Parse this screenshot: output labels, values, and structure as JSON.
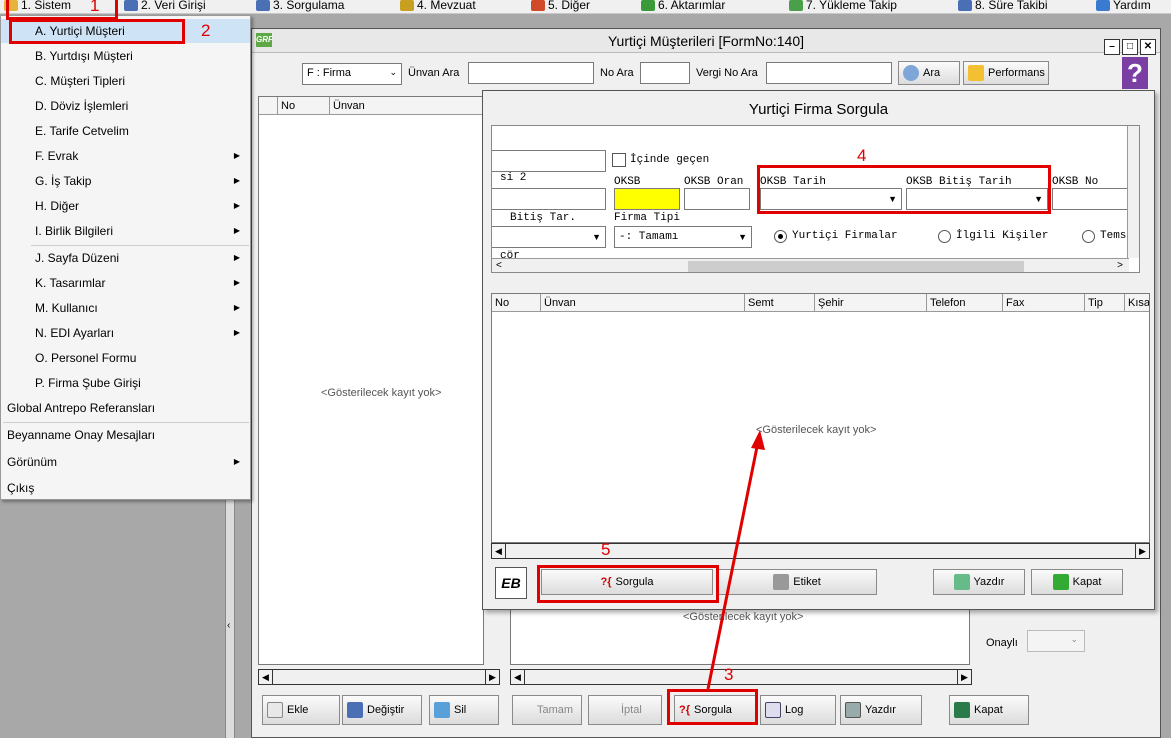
{
  "menubar": {
    "items": [
      {
        "label": "1. Sistem",
        "color": "#e8b33a"
      },
      {
        "label": "2. Veri Girişi",
        "color": "#4a6fb5"
      },
      {
        "label": "3. Sorgulama",
        "color": "#4a6fb5"
      },
      {
        "label": "4. Mevzuat",
        "color": "#c8a020"
      },
      {
        "label": "5. Diğer",
        "color": "#d04a2a"
      },
      {
        "label": "6. Aktarımlar",
        "color": "#3a9a3a"
      },
      {
        "label": "7. Yükleme Takip",
        "color": "#4aa04a"
      },
      {
        "label": "8. Süre Takibi",
        "color": "#4a6fb5"
      },
      {
        "label": "Yardım",
        "color": "#3a7ad0"
      }
    ]
  },
  "sistem_menu": {
    "items": [
      {
        "label": "A. Yurtiçi Müşteri",
        "submenu": false
      },
      {
        "label": "B. Yurtdışı Müşteri",
        "submenu": false
      },
      {
        "label": "C. Müşteri Tipleri",
        "submenu": false
      },
      {
        "label": "D. Döviz İşlemleri",
        "submenu": false
      },
      {
        "label": "E. Tarife Cetvelim",
        "submenu": false
      },
      {
        "label": "F. Evrak",
        "submenu": true
      },
      {
        "label": "G. İş Takip",
        "submenu": true
      },
      {
        "label": "H. Diğer",
        "submenu": true
      },
      {
        "label": "I. Birlik Bilgileri",
        "submenu": true
      },
      {
        "label": "J. Sayfa Düzeni",
        "submenu": true
      },
      {
        "label": "K. Tasarımlar",
        "submenu": true
      },
      {
        "label": "M. Kullanıcı",
        "submenu": true
      },
      {
        "label": "N. EDI Ayarları",
        "submenu": true
      },
      {
        "label": "O. Personel Formu",
        "submenu": false
      },
      {
        "label": "P. Firma Şube Girişi",
        "submenu": false
      },
      {
        "label": "Global Antrepo Referansları",
        "submenu": false
      },
      {
        "label": "Beyanname Onay Mesajları",
        "submenu": false
      },
      {
        "label": "Görünüm",
        "submenu": true
      },
      {
        "label": "Çıkış",
        "submenu": false
      }
    ]
  },
  "main_window": {
    "title": "Yurtiçi Müşterileri [FormNo:140]",
    "logo": "GRF",
    "type_select": "F : Firma",
    "unvan_label": "Ünvan Ara",
    "no_label": "No Ara",
    "vergi_label": "Vergi No Ara",
    "search_button": "Ara",
    "performance_button": "Performans",
    "help": "?",
    "left_grid": {
      "col_no": "No",
      "col_unvan": "Ünvan",
      "empty": "<Gösterilecek kayıt yok>"
    },
    "bottom_grid_empty": "<Gösterilecek kayıt yok>",
    "onayli_label": "Onaylı",
    "toolbar": {
      "ekle": "Ekle",
      "degistir": "Değiştir",
      "sil": "Sil",
      "tamam": "Tamam",
      "iptal": "İptal",
      "sorgula": "Sorgula",
      "log": "Log",
      "yazdir": "Yazdır",
      "kapat": "Kapat"
    }
  },
  "dialog": {
    "title": "Yurtiçi Firma Sorgula",
    "icinde_gecen": "İçinde geçen",
    "si2": "si 2",
    "oksb": "OKSB",
    "oksb_oran": "OKSB Oran",
    "oksb_tarih": "OKSB Tarih",
    "oksb_bitis_tarih": "OKSB Bitiş Tarih",
    "oksb_no": "OKSB No",
    "bitis_tar": "Bitiş Tar.",
    "firma_tipi": "Firma Tipi",
    "firma_tipi_value": "-: Tamamı",
    "cor": "cör",
    "radio_yurtici": "Yurtiçi Firmalar",
    "radio_ilgili": "İlgili Kişiler",
    "radio_tems": "Tems",
    "columns": [
      "No",
      "Ünvan",
      "Semt",
      "Şehir",
      "Telefon",
      "Fax",
      "Tip",
      "Kısa"
    ],
    "empty": "<Gösterilecek kayıt yok>",
    "sorgula": "Sorgula",
    "etiket": "Etiket",
    "yazdir": "Yazdır",
    "kapat": "Kapat",
    "eb_logo": "EB"
  },
  "annotations": [
    "1",
    "2",
    "3",
    "4",
    "5"
  ],
  "colors": {
    "annotation": "#e00000",
    "highlight": "#ffff00",
    "selected_menu": "#cfe3f6"
  }
}
